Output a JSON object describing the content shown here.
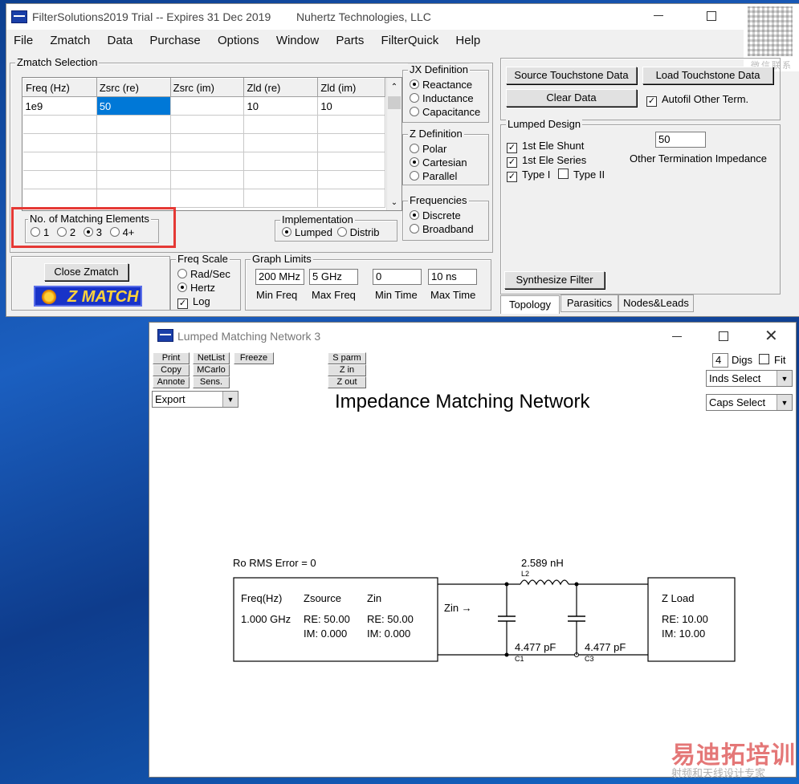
{
  "main_window": {
    "title": "FilterSolutions2019 Trial -- Expires 31 Dec 2019",
    "company": "Nuhertz Technologies, LLC",
    "menu": [
      "File",
      "Zmatch",
      "Data",
      "Purchase",
      "Options",
      "Window",
      "Parts",
      "FilterQuick",
      "Help"
    ],
    "zmatch_selection": {
      "label": "Zmatch Selection",
      "columns": [
        "Freq (Hz)",
        "Zsrc (re)",
        "Zsrc (im)",
        "Zld (re)",
        "Zld (im)"
      ],
      "rows": [
        [
          "1e9",
          "50",
          "",
          "10",
          "10"
        ],
        [
          "",
          "",
          "",
          "",
          ""
        ],
        [
          "",
          "",
          "",
          "",
          ""
        ],
        [
          "",
          "",
          "",
          "",
          ""
        ],
        [
          "",
          "",
          "",
          "",
          ""
        ],
        [
          "",
          "",
          "",
          "",
          ""
        ]
      ]
    },
    "jx_definition": {
      "label": "JX Definition",
      "options": [
        "Reactance",
        "Inductance",
        "Capacitance"
      ],
      "selected": "Reactance"
    },
    "z_definition": {
      "label": "Z Definition",
      "options": [
        "Polar",
        "Cartesian",
        "Parallel"
      ],
      "selected": "Cartesian"
    },
    "frequencies": {
      "label": "Frequencies",
      "options": [
        "Discrete",
        "Broadband"
      ],
      "selected": "Discrete"
    },
    "matching_elements": {
      "label": "No. of Matching Elements",
      "options": [
        "1",
        "2",
        "3",
        "4+"
      ],
      "selected": "3"
    },
    "implementation": {
      "label": "Implementation",
      "options": [
        "Lumped",
        "Distrib"
      ],
      "selected": "Lumped"
    },
    "close_button": "Close Zmatch",
    "logo_text": "Z MATCH",
    "freq_scale": {
      "label": "Freq Scale",
      "options": [
        "Rad/Sec",
        "Hertz"
      ],
      "selected": "Hertz",
      "log_label": "Log",
      "log_checked": true
    },
    "graph_limits": {
      "label": "Graph Limits",
      "min_freq": "200 MHz",
      "max_freq": "5 GHz",
      "min_time": "0",
      "max_time": "10 ns",
      "labels": [
        "Min Freq",
        "Max Freq",
        "Min Time",
        "Max Time"
      ]
    },
    "source_touchstone": "Source Touchstone Data",
    "load_touchstone": "Load Touchstone Data",
    "clear_data": "Clear Data",
    "autofil": "Autofil Other Term.",
    "lumped_design": {
      "label": "Lumped Design",
      "shunt": "1st Ele Shunt",
      "series": "1st Ele Series",
      "type1": "Type I",
      "type2": "Type II",
      "other_term_value": "50",
      "other_term_label": "Other Termination Impedance"
    },
    "synthesize": "Synthesize Filter",
    "tabs": [
      "Topology",
      "Parasitics",
      "Nodes&Leads"
    ]
  },
  "network_window": {
    "title": "Lumped Matching Network 3",
    "buttons_left": [
      [
        "Print",
        "NetList"
      ],
      [
        "Copy",
        "MCarlo"
      ],
      [
        "Annote",
        "Sens."
      ]
    ],
    "freeze": "Freeze",
    "buttons_mid": [
      "S parm",
      "Z in",
      "Z out"
    ],
    "export": "Export",
    "digs_value": "4",
    "digs_label": "Digs",
    "fit_label": "Fit",
    "inds_select": "Inds Select",
    "caps_select": "Caps Select",
    "heading": "Impedance Matching Network",
    "error": "Ro RMS Error = 0",
    "source_box": {
      "freq_h": "Freq(Hz)",
      "zsource_h": "Zsource",
      "zin_h": "Zin",
      "freq": "1.000 GHz",
      "zs_re": "RE: 50.00",
      "zs_im": "IM: 0.000",
      "zin_re": "RE: 50.00",
      "zin_im": "IM: 0.000"
    },
    "zin_arrow": "Zin →",
    "inductor_value": "2.589 nH",
    "inductor_ref": "L2",
    "c1_value": "4.477 pF",
    "c1_ref": "C1",
    "c3_value": "4.477 pF",
    "c3_ref": "C3",
    "load_box": {
      "title": "Z Load",
      "re": "RE: 10.00",
      "im": "IM: 10.00"
    }
  },
  "watermark": {
    "qr_caption": "微信联系",
    "brand": "易迪拓培训",
    "sub": "射频和天线设计专家"
  }
}
